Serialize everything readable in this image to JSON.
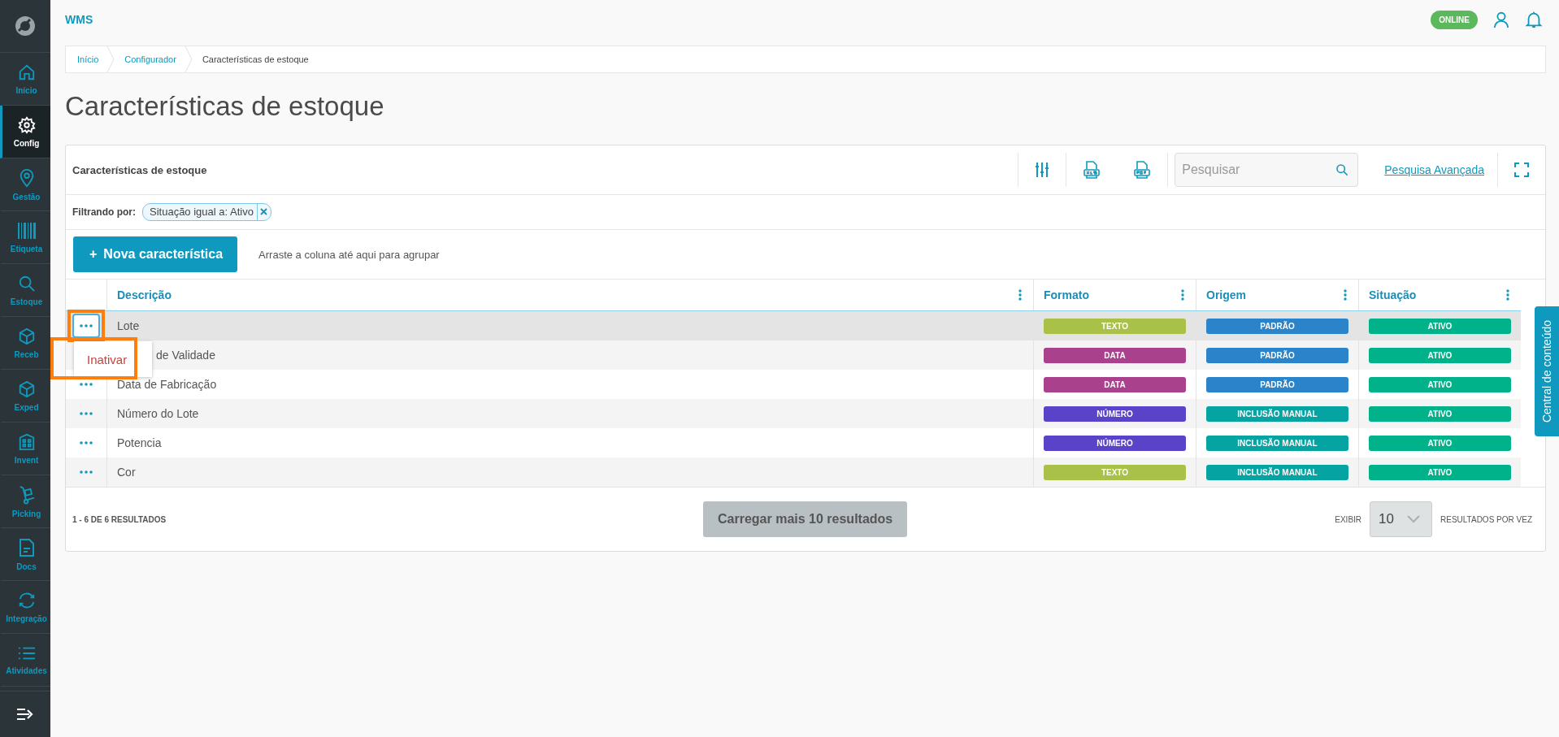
{
  "app": {
    "name": "WMS",
    "status": "ONLINE"
  },
  "sidebar": {
    "items": [
      {
        "label": "Início",
        "kind": "home",
        "selected": false
      },
      {
        "label": "Config",
        "kind": "gear",
        "selected": true
      },
      {
        "label": "Gestão",
        "kind": "pin",
        "selected": false
      },
      {
        "label": "Etiqueta",
        "kind": "barcode",
        "selected": false
      },
      {
        "label": "Estoque",
        "kind": "search",
        "selected": false
      },
      {
        "label": "Receb",
        "kind": "box",
        "selected": false
      },
      {
        "label": "Exped",
        "kind": "box",
        "selected": false
      },
      {
        "label": "Invent",
        "kind": "building",
        "selected": false
      },
      {
        "label": "Picking",
        "kind": "truck",
        "selected": false
      },
      {
        "label": "Docs",
        "kind": "doc",
        "selected": false
      },
      {
        "label": "Integração",
        "kind": "sync",
        "selected": false
      },
      {
        "label": "Atividades",
        "kind": "list",
        "selected": false
      }
    ]
  },
  "breadcrumb": [
    "Início",
    "Configurador",
    "Características de estoque"
  ],
  "page_title": "Características de estoque",
  "card": {
    "title": "Características de estoque",
    "search_placeholder": "Pesquisar",
    "advanced_search": "Pesquisa Avançada"
  },
  "filter": {
    "label": "Filtrando por:",
    "chips": [
      "Situação igual a: Ativo"
    ]
  },
  "new_button": {
    "icon": "+",
    "label": "Nova característica"
  },
  "group_hint": "Arraste a coluna até aqui para agrupar",
  "table": {
    "columns": [
      "Descrição",
      "Formato",
      "Origem",
      "Situação"
    ],
    "rows": [
      {
        "description": "Lote",
        "selected": true,
        "menu_button": true,
        "menu_highlighted": true,
        "formato": {
          "text": "TEXTO",
          "color": "#a9c148"
        },
        "origem": {
          "text": "PADRÃO",
          "color": "#2b84c9"
        },
        "situacao": {
          "text": "ATIVO",
          "color": "#00b28a"
        }
      },
      {
        "description": "de Validade",
        "selected": false,
        "menu_button": false,
        "menu_highlighted": false,
        "formato": {
          "text": "DATA",
          "color": "#a9418c"
        },
        "origem": {
          "text": "PADRÃO",
          "color": "#2b84c9"
        },
        "situacao": {
          "text": "ATIVO",
          "color": "#00b28a"
        }
      },
      {
        "description": "Data de Fabricação",
        "selected": false,
        "menu_button": true,
        "menu_highlighted": false,
        "formato": {
          "text": "DATA",
          "color": "#a9418c"
        },
        "origem": {
          "text": "PADRÃO",
          "color": "#2b84c9"
        },
        "situacao": {
          "text": "ATIVO",
          "color": "#00b28a"
        }
      },
      {
        "description": "Número do Lote",
        "selected": false,
        "menu_button": true,
        "menu_highlighted": false,
        "formato": {
          "text": "NÚMERO",
          "color": "#5a43c8"
        },
        "origem": {
          "text": "INCLUSÃO MANUAL",
          "color": "#06a3a3"
        },
        "situacao": {
          "text": "ATIVO",
          "color": "#00b28a"
        }
      },
      {
        "description": "Potencia",
        "selected": false,
        "menu_button": true,
        "menu_highlighted": false,
        "formato": {
          "text": "NÚMERO",
          "color": "#5a43c8"
        },
        "origem": {
          "text": "INCLUSÃO MANUAL",
          "color": "#06a3a3"
        },
        "situacao": {
          "text": "ATIVO",
          "color": "#00b28a"
        }
      },
      {
        "description": "Cor",
        "selected": false,
        "menu_button": true,
        "menu_highlighted": false,
        "formato": {
          "text": "TEXTO",
          "color": "#a9c148"
        },
        "origem": {
          "text": "INCLUSÃO MANUAL",
          "color": "#06a3a3"
        },
        "situacao": {
          "text": "ATIVO",
          "color": "#00b28a"
        }
      }
    ]
  },
  "context_menu": {
    "items": [
      "Inativar"
    ],
    "highlighted": true
  },
  "footer": {
    "count": "1 - 6 DE 6 RESULTADOS",
    "load_more": "Carregar mais 10 resultados",
    "load_more_disabled": true,
    "show_label": "EXIBIR",
    "page_size": "10",
    "per_page_label": "RESULTADOS POR VEZ"
  },
  "side_tab": "Central de conteúdo"
}
